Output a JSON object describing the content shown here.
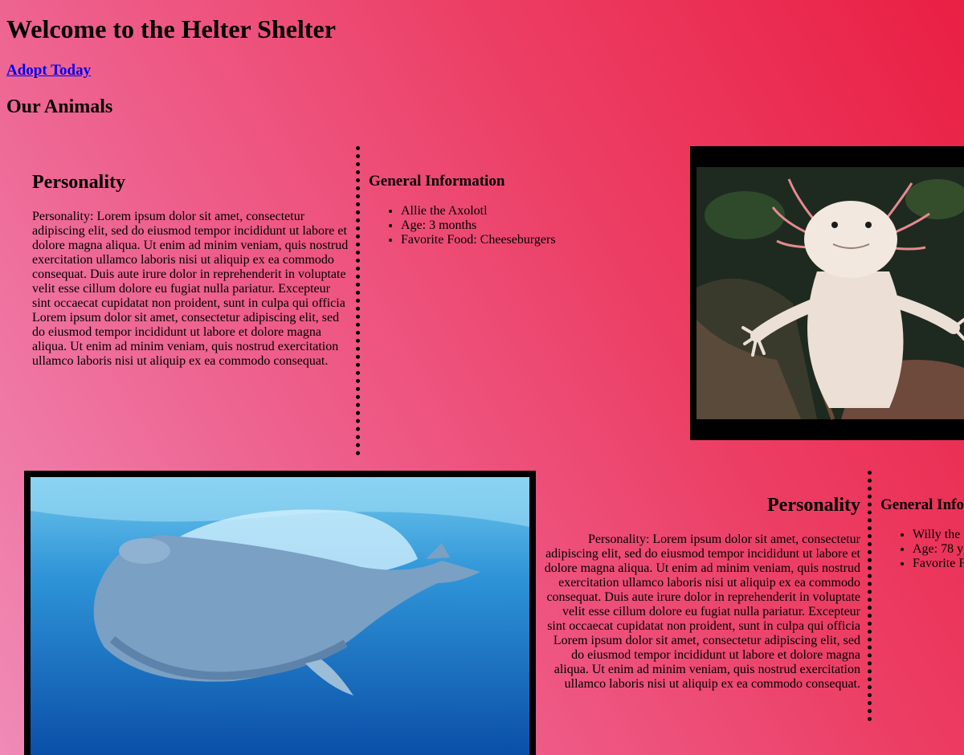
{
  "header": {
    "title": "Welcome to the Helter Shelter",
    "adopt_link": "Adopt Today",
    "section_title": "Our Animals"
  },
  "animals": [
    {
      "personality_heading": "Personality",
      "personality_text": "Personality: Lorem ipsum dolor sit amet, consectetur adipiscing elit, sed do eiusmod tempor incididunt ut labore et dolore magna aliqua. Ut enim ad minim veniam, quis nostrud exercitation ullamco laboris nisi ut aliquip ex ea commodo consequat. Duis aute irure dolor in reprehenderit in voluptate velit esse cillum dolore eu fugiat nulla pariatur. Excepteur sint occaecat cupidatat non proident, sunt in culpa qui officia Lorem ipsum dolor sit amet, consectetur adipiscing elit, sed do eiusmod tempor incididunt ut labore et dolore magna aliqua. Ut enim ad minim veniam, quis nostrud exercitation ullamco laboris nisi ut aliquip ex ea commodo consequat.",
      "info_heading": "General Information",
      "info": [
        "Allie the Axolotl",
        "Age: 3 months",
        "Favorite Food: Cheeseburgers"
      ],
      "photo": "axolotl-photo"
    },
    {
      "personality_heading": "Personality",
      "personality_text": "Personality: Lorem ipsum dolor sit amet, consectetur adipiscing elit, sed do eiusmod tempor incididunt ut labore et dolore magna aliqua. Ut enim ad minim veniam, quis nostrud exercitation ullamco laboris nisi ut aliquip ex ea commodo consequat. Duis aute irure dolor in reprehenderit in voluptate velit esse cillum dolore eu fugiat nulla pariatur. Excepteur sint occaecat cupidatat non proident, sunt in culpa qui officia Lorem ipsum dolor sit amet, consectetur adipiscing elit, sed do eiusmod tempor incididunt ut labore et dolore magna aliqua. Ut enim ad minim veniam, quis nostrud exercitation ullamco laboris nisi ut aliquip ex ea commodo consequat.",
      "info_heading": "General Infor",
      "info": [
        "Willy the",
        "Age: 78 y",
        "Favorite F"
      ],
      "photo": "whale-photo"
    }
  ],
  "colors": {
    "background_start": "#f08ab6",
    "background_end": "#ea1f44",
    "link": "#0000ee",
    "frame": "#000000"
  }
}
